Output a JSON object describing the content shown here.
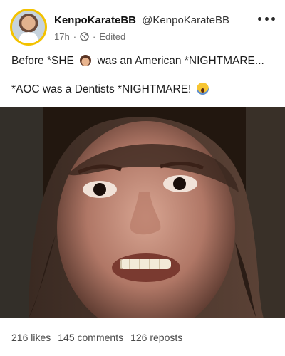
{
  "post": {
    "display_name": "KenpoKarateBB",
    "handle": "@KenpoKarateBB",
    "time": "17h",
    "edited": "Edited",
    "text_line1_part1": "Before *SHE",
    "text_line1_part2": "was an American *NIGHTMARE...",
    "text_line2": "*AOC was a Dentists *NIGHTMARE!"
  },
  "icons": {
    "visibility": "globe-icon",
    "more": "more-options-icon",
    "inline_emoji_1": "woman-face-emoji",
    "inline_emoji_2": "screaming-face-emoji"
  },
  "stats": {
    "likes": "216 likes",
    "comments": "145 comments",
    "reposts": "126 reposts"
  },
  "colors": {
    "avatar_ring": "#f3c200",
    "text_primary": "#1c1c1c",
    "text_secondary": "#6b6b6b"
  }
}
